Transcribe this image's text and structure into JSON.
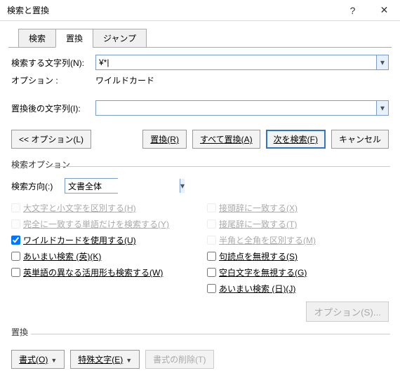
{
  "window": {
    "title": "検索と置換"
  },
  "tabs": {
    "find": "検索",
    "replace": "置換",
    "goto": "ジャンプ"
  },
  "fields": {
    "find_label": "検索する文字列(N):",
    "find_value": "¥*|",
    "option_label": "オプション :",
    "option_value": "ワイルドカード",
    "replace_label": "置換後の文字列(I):",
    "replace_value": ""
  },
  "buttons": {
    "less_options": "<< オプション(L)",
    "replace": "置換(R)",
    "replace_all": "すべて置換(A)",
    "find_next": "次を検索(F)",
    "cancel": "キャンセル"
  },
  "search_options": {
    "heading": "検索オプション",
    "direction_label": "検索方向(:)",
    "direction_value": "文書全体",
    "match_case": "大文字と小文字を区別する(H)",
    "whole_word": "完全に一致する単語だけを検索する(Y)",
    "wildcards": "ワイルドカードを使用する(U)",
    "sounds_like_en": "あいまい検索 (英)(K)",
    "word_forms_en": "英単語の異なる活用形も検索する(W)",
    "match_prefix": "接頭辞に一致する(X)",
    "match_suffix": "接尾辞に一致する(T)",
    "half_full": "半角と全角を区別する(M)",
    "ignore_punct": "句読点を無視する(S)",
    "ignore_ws": "空白文字を無視する(G)",
    "sounds_like_jp": "あいまい検索 (日)(J)",
    "fuzzy_options": "オプション(S)..."
  },
  "replace_section": {
    "heading": "置換",
    "format": "書式(O)",
    "special": "特殊文字(E)",
    "clear_format": "書式の削除(T)"
  }
}
